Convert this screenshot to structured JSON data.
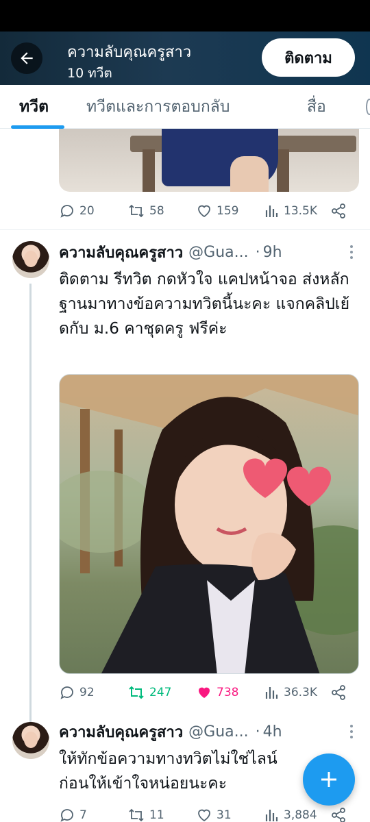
{
  "header": {
    "title": "ความลับคุณครูสาว",
    "subtitle": "10 ทวีต",
    "follow_label": "ติดตาม"
  },
  "tabs": [
    {
      "label": "ทวีต",
      "active": true
    },
    {
      "label": "ทวีตและการตอบกลับ",
      "active": false
    },
    {
      "label": "สื่อ",
      "active": false
    }
  ],
  "colors": {
    "accent": "#1d9bf0",
    "retweet_active": "#00ba7c",
    "like_active": "#f91880",
    "muted": "#536471"
  },
  "prev_tweet": {
    "stats": {
      "replies": "20",
      "retweets": "58",
      "likes": "159",
      "views": "13.5K"
    }
  },
  "tweet1": {
    "name": "ความลับคุณครูสาว",
    "handle": "@Gua...",
    "time": "9h",
    "text": "ติดตาม รีทวิต กดหัวใจ แคปหน้าจอ ส่งหลักฐานมาทางข้อความทวิตนี้นะคะ แจกคลิปเย้ดกับ ม.6 คาชุดครู ฟรีค่ะ",
    "stats": {
      "replies": "92",
      "retweets": "247",
      "likes": "738",
      "views": "36.3K"
    },
    "retweeted": true,
    "liked": true
  },
  "tweet2": {
    "name": "ความลับคุณครูสาว",
    "handle": "@Gua...",
    "time": "4h",
    "text": "ให้ทักข้อความทางทวิตไม่ใช่ไลน์ ก่อนให้เข้าใจหน่อยนะคะ",
    "stats": {
      "replies": "7",
      "retweets": "11",
      "likes": "31",
      "views": "3,884"
    }
  },
  "icons": {
    "back": "arrow-left-icon",
    "reply": "speech-bubble-icon",
    "retweet": "retweet-arrows-icon",
    "like": "heart-icon",
    "views": "bar-chart-icon",
    "share": "share-nodes-icon",
    "compose": "plus-icon"
  }
}
